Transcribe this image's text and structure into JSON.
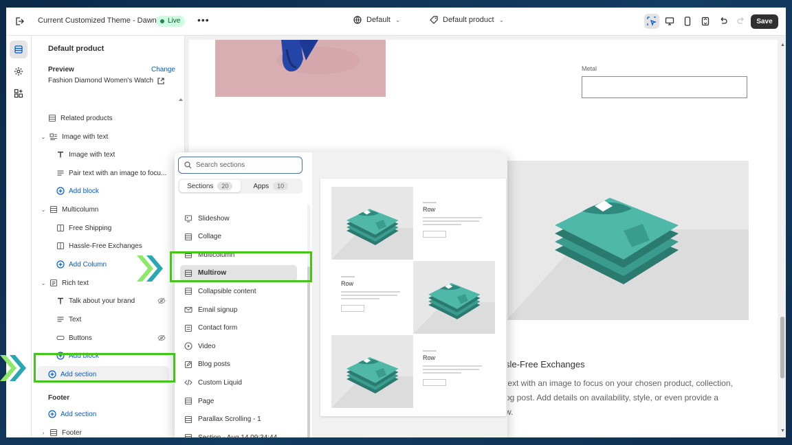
{
  "topbar": {
    "theme_name": "Current Customized Theme - Dawn",
    "live_label": "Live",
    "market_select": "Default",
    "template_select": "Default product",
    "save_label": "Save"
  },
  "sidebar": {
    "title": "Default product",
    "preview_label": "Preview",
    "change_label": "Change",
    "preview_product": "Fashion Diamond Women's Watch",
    "footer_label": "Footer",
    "tree": [
      {
        "label": "Related products",
        "level": 1,
        "icon": "section-icon"
      },
      {
        "label": "Image with text",
        "level": 0,
        "icon": "image-text-icon",
        "expanded": true
      },
      {
        "label": "Image with text",
        "level": 2,
        "icon": "text-icon"
      },
      {
        "label": "Pair text with an image to focu...",
        "level": 2,
        "icon": "paragraph-icon"
      },
      {
        "label": "Add block",
        "level": 2,
        "icon": "plus-circle-icon",
        "add": true
      },
      {
        "label": "Multicolumn",
        "level": 0,
        "icon": "section-icon",
        "expanded": true
      },
      {
        "label": "Free Shipping",
        "level": 2,
        "icon": "column-icon"
      },
      {
        "label": "Hassle-Free Exchanges",
        "level": 2,
        "icon": "column-icon"
      },
      {
        "label": "Add Column",
        "level": 2,
        "icon": "plus-circle-icon",
        "add": true
      },
      {
        "label": "Rich text",
        "level": 0,
        "icon": "richtext-icon",
        "expanded": true
      },
      {
        "label": "Talk about your brand",
        "level": 2,
        "icon": "text-icon",
        "hidden": true
      },
      {
        "label": "Text",
        "level": 2,
        "icon": "paragraph-icon"
      },
      {
        "label": "Buttons",
        "level": 2,
        "icon": "buttons-icon",
        "hidden": true
      },
      {
        "label": "Add block",
        "level": 2,
        "icon": "plus-circle-icon",
        "add": true
      },
      {
        "label": "Add section",
        "level": 1,
        "icon": "plus-circle-icon",
        "add": true,
        "highlight": true
      },
      {
        "label": "Add section",
        "level": 1,
        "icon": "plus-circle-icon",
        "add": true,
        "footer": true
      },
      {
        "label": "Footer",
        "level": 0,
        "icon": "section-icon"
      }
    ]
  },
  "picker": {
    "search_placeholder": "Search sections",
    "tabs": [
      {
        "label": "Sections",
        "count": "20",
        "active": true
      },
      {
        "label": "Apps",
        "count": "10",
        "active": false
      }
    ],
    "items": [
      {
        "label": "Slideshow",
        "icon": "slideshow-icon"
      },
      {
        "label": "Collage",
        "icon": "section-icon"
      },
      {
        "label": "Multicolumn",
        "icon": "section-icon"
      },
      {
        "label": "Multirow",
        "icon": "section-icon",
        "selected": true
      },
      {
        "label": "Collapsible content",
        "icon": "section-icon"
      },
      {
        "label": "Email signup",
        "icon": "email-icon"
      },
      {
        "label": "Contact form",
        "icon": "form-icon"
      },
      {
        "label": "Video",
        "icon": "play-icon"
      },
      {
        "label": "Blog posts",
        "icon": "edit-icon"
      },
      {
        "label": "Custom Liquid",
        "icon": "code-icon"
      },
      {
        "label": "Page",
        "icon": "section-icon"
      },
      {
        "label": "Parallax Scrolling - 1",
        "icon": "section-icon"
      },
      {
        "label": "Section - Aug 14 09:34:44",
        "icon": "section-icon"
      }
    ],
    "preview_rows": [
      {
        "title": "Row",
        "image_side": "left"
      },
      {
        "title": "Row",
        "image_side": "right"
      },
      {
        "title": "Row",
        "image_side": "left"
      }
    ]
  },
  "preview": {
    "metal_label": "Metal",
    "heading_partial": "sle-Free Exchanges",
    "text_lines": [
      "text with an image to focus on your chosen product, collection,",
      "og post. Add details on availability, style, or even provide a",
      "w."
    ]
  },
  "colors": {
    "highlight_green": "#45c51a",
    "chevron_light": "#8de86a",
    "chevron_teal": "#2aa7b3",
    "accent_link": "#005bd3",
    "tshirt": "#4fb8a8"
  }
}
